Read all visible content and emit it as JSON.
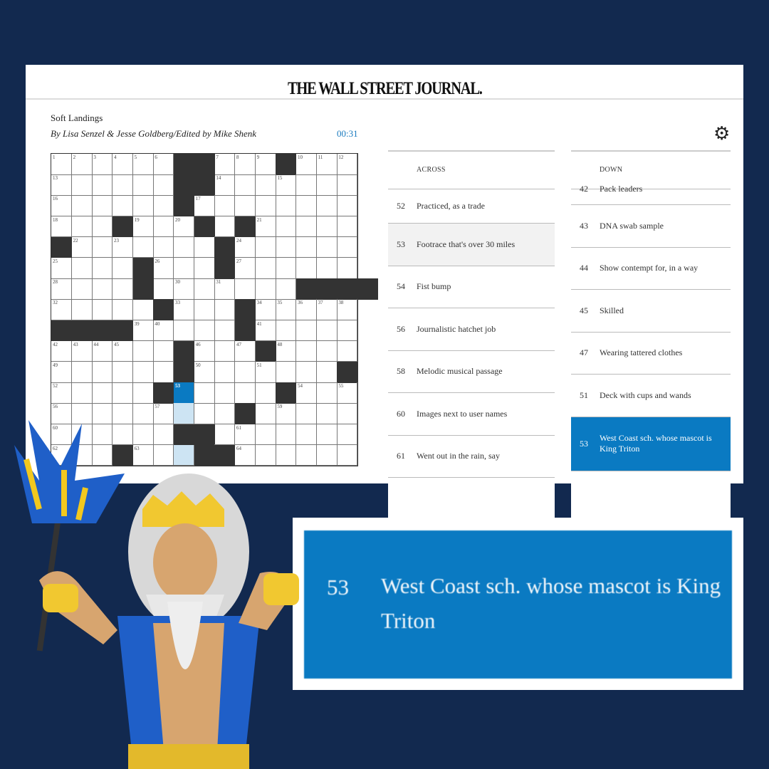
{
  "masthead": "THE WALL STREET JOURNAL.",
  "puzzle": {
    "title": "Soft Landings",
    "byline": "By Lisa Senzel & Jesse Goldberg/Edited by Mike Shenk",
    "timer": "00:31"
  },
  "settings_icon": "gear-icon",
  "grid": {
    "rows": [
      "......##...#...",
      "......##.......",
      "......#........",
      "...#...#.#.....",
      "#.......#......",
      "....#...#......",
      "....#.......####",
      ".....#...#.....",
      "####.....#.....",
      "......#...#....",
      "......#.......#",
      ".....#.....#...",
      ".........#.....",
      "......##.......",
      "...#...##......"
    ],
    "numbers": [
      [
        1,
        2,
        3,
        4,
        5,
        6,
        0,
        0,
        7,
        8,
        9,
        0,
        10,
        11,
        12
      ],
      [
        13,
        0,
        0,
        0,
        0,
        0,
        0,
        0,
        14,
        0,
        0,
        15,
        0,
        0,
        0
      ],
      [
        16,
        0,
        0,
        0,
        0,
        0,
        0,
        17,
        0,
        0,
        0,
        0,
        0,
        0,
        0
      ],
      [
        18,
        0,
        0,
        0,
        19,
        0,
        20,
        0,
        0,
        0,
        21,
        0,
        0,
        0,
        0
      ],
      [
        0,
        22,
        0,
        23,
        0,
        0,
        0,
        0,
        0,
        24,
        0,
        0,
        0,
        0,
        0
      ],
      [
        25,
        0,
        0,
        0,
        0,
        26,
        0,
        0,
        0,
        27,
        0,
        0,
        0,
        0,
        0
      ],
      [
        28,
        0,
        0,
        0,
        29,
        0,
        30,
        0,
        31,
        0,
        0,
        0,
        0,
        0,
        0
      ],
      [
        32,
        0,
        0,
        0,
        0,
        0,
        33,
        0,
        0,
        0,
        34,
        35,
        36,
        37,
        38
      ],
      [
        0,
        0,
        0,
        0,
        39,
        40,
        0,
        0,
        0,
        0,
        41,
        0,
        0,
        0,
        0
      ],
      [
        42,
        43,
        44,
        45,
        0,
        0,
        0,
        46,
        0,
        47,
        0,
        48,
        0,
        0,
        0
      ],
      [
        49,
        0,
        0,
        0,
        0,
        0,
        0,
        50,
        0,
        0,
        51,
        0,
        0,
        0,
        0
      ],
      [
        52,
        0,
        0,
        0,
        0,
        0,
        53,
        0,
        0,
        0,
        0,
        0,
        54,
        0,
        55
      ],
      [
        56,
        0,
        0,
        0,
        0,
        57,
        0,
        0,
        0,
        58,
        0,
        59,
        0,
        0,
        0
      ],
      [
        60,
        0,
        0,
        0,
        0,
        0,
        0,
        0,
        0,
        61,
        0,
        0,
        0,
        0,
        0
      ],
      [
        62,
        0,
        0,
        0,
        63,
        0,
        0,
        0,
        0,
        64,
        0,
        0,
        0,
        0,
        0
      ]
    ],
    "selected_cell": "53",
    "highlight_color": "#cde4f3",
    "selected_color": "#0a7ac2"
  },
  "across": {
    "header": "ACROSS",
    "clues": [
      {
        "n": "52",
        "text": "Practiced, as a trade"
      },
      {
        "n": "53",
        "text": "Footrace that's over 30 miles",
        "state": "gray"
      },
      {
        "n": "54",
        "text": "Fist bump"
      },
      {
        "n": "56",
        "text": "Journalistic hatchet job"
      },
      {
        "n": "58",
        "text": "Melodic musical passage"
      },
      {
        "n": "60",
        "text": "Images next to user names"
      },
      {
        "n": "61",
        "text": "Went out in the rain, say"
      }
    ]
  },
  "down": {
    "header": "DOWN",
    "clues": [
      {
        "n": "42",
        "text": "Pack leaders",
        "state": "clipped"
      },
      {
        "n": "43",
        "text": "DNA swab sample"
      },
      {
        "n": "44",
        "text": "Show contempt for, in a way"
      },
      {
        "n": "45",
        "text": "Skilled"
      },
      {
        "n": "47",
        "text": "Wearing tattered clothes"
      },
      {
        "n": "51",
        "text": "Deck with cups and wands"
      },
      {
        "n": "53",
        "text": "West Coast sch. whose mascot is King Triton",
        "state": "active"
      }
    ]
  },
  "callout": {
    "n": "53",
    "text": "West Coast sch. whose mascot is King Triton"
  },
  "colors": {
    "background": "#12294f",
    "accent": "#0a7ac2"
  }
}
